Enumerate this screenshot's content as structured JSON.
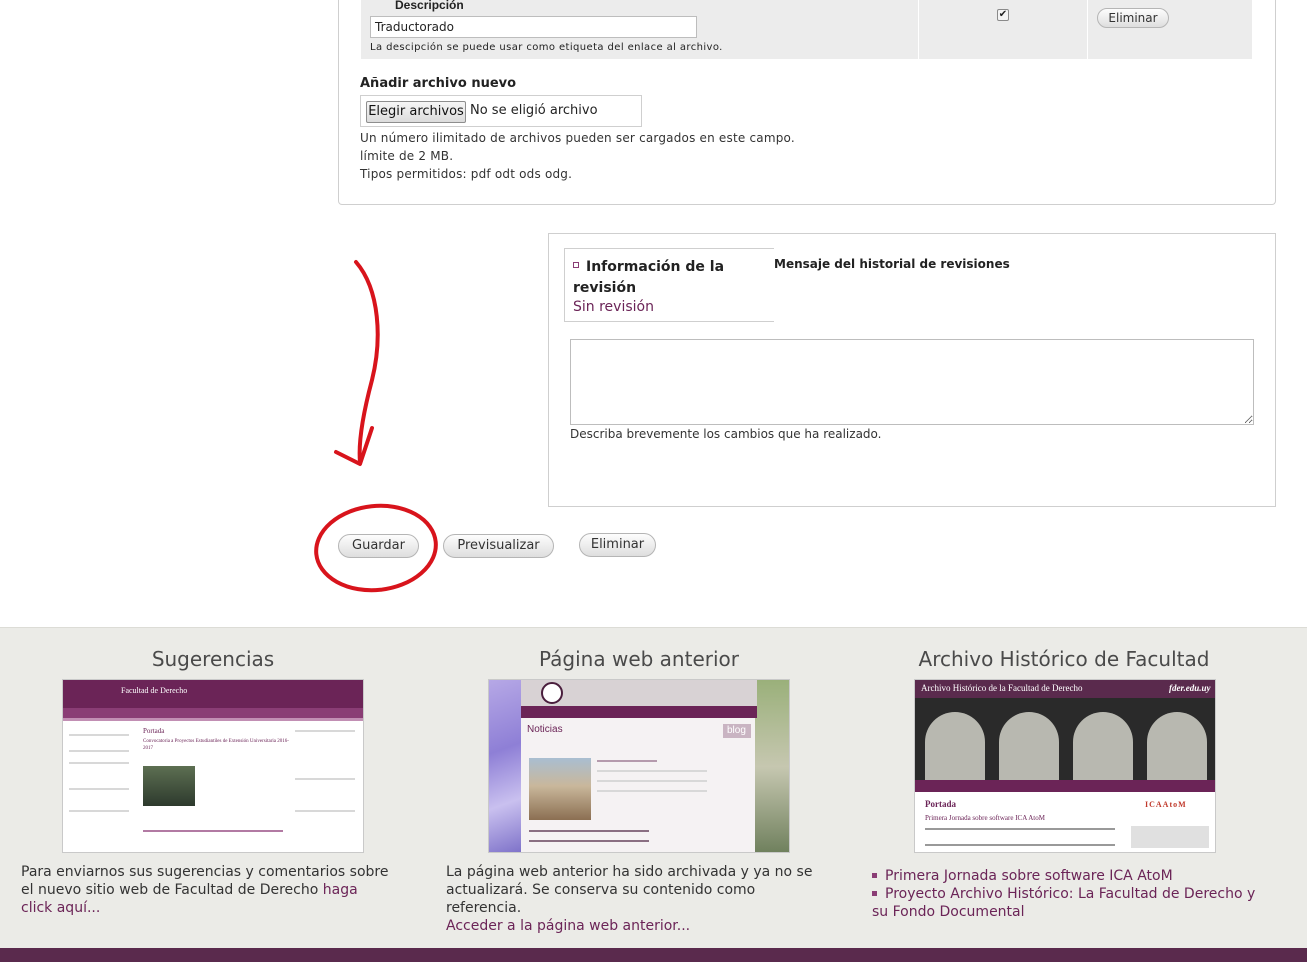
{
  "upload": {
    "description_label": "Descripción",
    "description_value": "Traductorado",
    "description_help": "La descipción se puede usar como etiqueta del enlace al archivo.",
    "remove_row_label": "Eliminar",
    "display_checked": true,
    "add_new_label": "Añadir archivo nuevo",
    "choose_files_label": "Elegir archivos",
    "no_file_label": "No se eligió archivo",
    "help_lines": [
      "Un número ilimitado de archivos pueden ser cargados en este campo.",
      "límite de 2 MB.",
      "Tipos permitidos: pdf odt ods odg."
    ]
  },
  "revision": {
    "tab_title": "Información de la revisión",
    "tab_summary": "Sin revisión",
    "message_label": "Mensaje del historial de revisiones",
    "message_value": "",
    "message_help": "Describa brevemente los cambios que ha realizado."
  },
  "actions": {
    "save": "Guardar",
    "preview": "Previsualizar",
    "delete": "Eliminar"
  },
  "footer": {
    "col1": {
      "title": "Sugerencias",
      "text": "Para enviarnos sus sugerencias y comentarios sobre el nuevo sitio web de Facultad de Derecho ",
      "link": "haga click aquí..."
    },
    "col2": {
      "title": "Página web anterior",
      "text": "La página web anterior ha sido archivada y ya no se actualizará. Se conserva su contenido como referencia.",
      "link": "Acceder a la página web anterior..."
    },
    "col3": {
      "title": "Archivo Histórico de Facultad",
      "links": [
        "Primera Jornada sobre software ICA AtoM",
        "Proyecto Archivo Histórico: La Facultad de Derecho y su Fondo Documental"
      ]
    }
  },
  "thumbs": {
    "t1": {
      "site": "Facultad de Derecho",
      "heading": "Portada",
      "news": "Convocatoria a Proyectos Estudiantiles de Extensión Universitaria 2016-2017"
    },
    "t2": {
      "heading": "Noticias",
      "blog": "blog"
    },
    "t3": {
      "banner": "Archivo Histórico de la Facultad de Derecho",
      "domain": "fder.edu.uy",
      "heading": "Portada",
      "news": "Primera Jornada sobre software ICA AtoM",
      "atom": "ICAAtoM"
    }
  },
  "colors": {
    "brand": "#6b2457",
    "footer_bg": "#ebebe7",
    "annotation": "#d8141c"
  }
}
